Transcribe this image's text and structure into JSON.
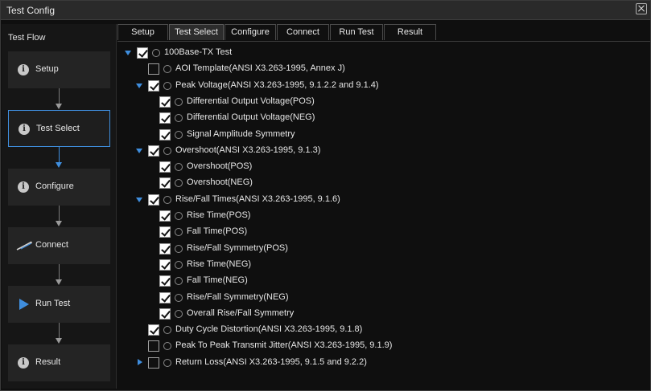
{
  "window": {
    "title": "Test Config"
  },
  "flow": {
    "title": "Test Flow",
    "steps": [
      {
        "label": "Setup",
        "icon": "info-icon",
        "active": false
      },
      {
        "label": "Test Select",
        "icon": "info-icon",
        "active": true
      },
      {
        "label": "Configure",
        "icon": "info-icon",
        "active": false
      },
      {
        "label": "Connect",
        "icon": "probe-icon",
        "active": false
      },
      {
        "label": "Run Test",
        "icon": "play-icon",
        "active": false
      },
      {
        "label": "Result",
        "icon": "info-icon",
        "active": false
      }
    ]
  },
  "tabs": [
    "Setup",
    "Test Select",
    "Configure",
    "Connect",
    "Run Test",
    "Result"
  ],
  "active_tab": "Test Select",
  "tree": [
    {
      "label": "100Base-TX Test",
      "level": 0,
      "expander": "expanded",
      "checked": true
    },
    {
      "label": "AOI Template(ANSI X3.263-1995, Annex J)",
      "level": 1,
      "expander": "none",
      "checked": false
    },
    {
      "label": "Peak Voltage(ANSI X3.263-1995, 9.1.2.2 and 9.1.4)",
      "level": 1,
      "expander": "expanded",
      "checked": true
    },
    {
      "label": "Differential Output Voltage(POS)",
      "level": 2,
      "expander": "none",
      "checked": true
    },
    {
      "label": "Differential Output Voltage(NEG)",
      "level": 2,
      "expander": "none",
      "checked": true
    },
    {
      "label": "Signal Amplitude Symmetry",
      "level": 2,
      "expander": "none",
      "checked": true
    },
    {
      "label": "Overshoot(ANSI X3.263-1995, 9.1.3)",
      "level": 1,
      "expander": "expanded",
      "checked": true
    },
    {
      "label": "Overshoot(POS)",
      "level": 2,
      "expander": "none",
      "checked": true
    },
    {
      "label": "Overshoot(NEG)",
      "level": 2,
      "expander": "none",
      "checked": true
    },
    {
      "label": "Rise/Fall Times(ANSI X3.263-1995, 9.1.6)",
      "level": 1,
      "expander": "expanded",
      "checked": true
    },
    {
      "label": "Rise Time(POS)",
      "level": 2,
      "expander": "none",
      "checked": true
    },
    {
      "label": "Fall Time(POS)",
      "level": 2,
      "expander": "none",
      "checked": true
    },
    {
      "label": "Rise/Fall Symmetry(POS)",
      "level": 2,
      "expander": "none",
      "checked": true
    },
    {
      "label": "Rise Time(NEG)",
      "level": 2,
      "expander": "none",
      "checked": true
    },
    {
      "label": "Fall Time(NEG)",
      "level": 2,
      "expander": "none",
      "checked": true
    },
    {
      "label": "Rise/Fall Symmetry(NEG)",
      "level": 2,
      "expander": "none",
      "checked": true
    },
    {
      "label": "Overall Rise/Fall Symmetry",
      "level": 2,
      "expander": "none",
      "checked": true
    },
    {
      "label": "Duty Cycle Distortion(ANSI X3.263-1995, 9.1.8)",
      "level": 1,
      "expander": "none",
      "checked": true
    },
    {
      "label": "Peak To Peak Transmit Jitter(ANSI X3.263-1995, 9.1.9)",
      "level": 1,
      "expander": "none",
      "checked": false
    },
    {
      "label": "Return Loss(ANSI X3.263-1995, 9.1.5 and 9.2.2)",
      "level": 1,
      "expander": "collapsed",
      "checked": false
    }
  ],
  "colors": {
    "accent": "#3f8ede",
    "panel": "#242424",
    "background": "#0f0f0f"
  }
}
